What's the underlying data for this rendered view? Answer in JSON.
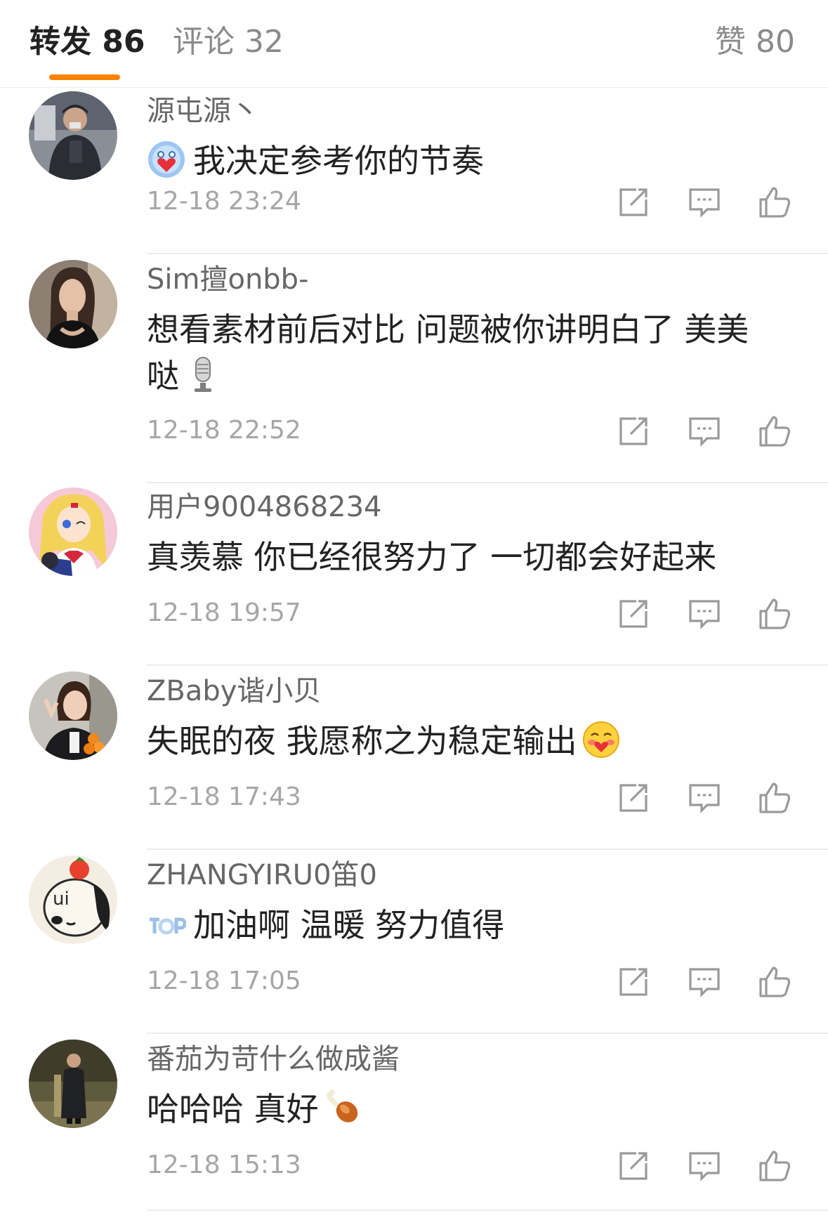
{
  "tabs": {
    "repost": "转发 86",
    "comment": "评论 32",
    "like": "赞 80"
  },
  "colors": {
    "accent": "#ff8200",
    "text_primary": "#222222",
    "text_secondary": "#666666",
    "text_meta": "#a6a6a6",
    "divider": "#ececec"
  },
  "comments": [
    {
      "user": "源屯源丶",
      "text": "我决定参考你的节奏",
      "time": "12-18 23:24",
      "emoji": "heart-holding-emoji"
    },
    {
      "user": "Sim擅onbb-",
      "text": "想看素材前后对比 问题被你讲明白了 美美哒",
      "time": "12-18 22:52",
      "emoji": "microphone-emoji"
    },
    {
      "user": "用户9004868234",
      "text": "真羡慕 你已经很努力了 一切都会好起来",
      "time": "12-18 19:57"
    },
    {
      "user": "ZBaby谐小贝",
      "text": "失眠的夜 我愿称之为稳定输出",
      "time": "12-18 17:43",
      "emoji": "blushing-face-emoji"
    },
    {
      "user": "ZHANGYIRU0笛0",
      "text": "加油啊 温暖 努力值得",
      "time": "12-18 17:05",
      "emoji": "top-badge-emoji"
    },
    {
      "user": "番茄为苛什么做成酱",
      "text": "哈哈哈 真好",
      "time": "12-18 15:13",
      "emoji": "chicken-leg-emoji"
    }
  ]
}
